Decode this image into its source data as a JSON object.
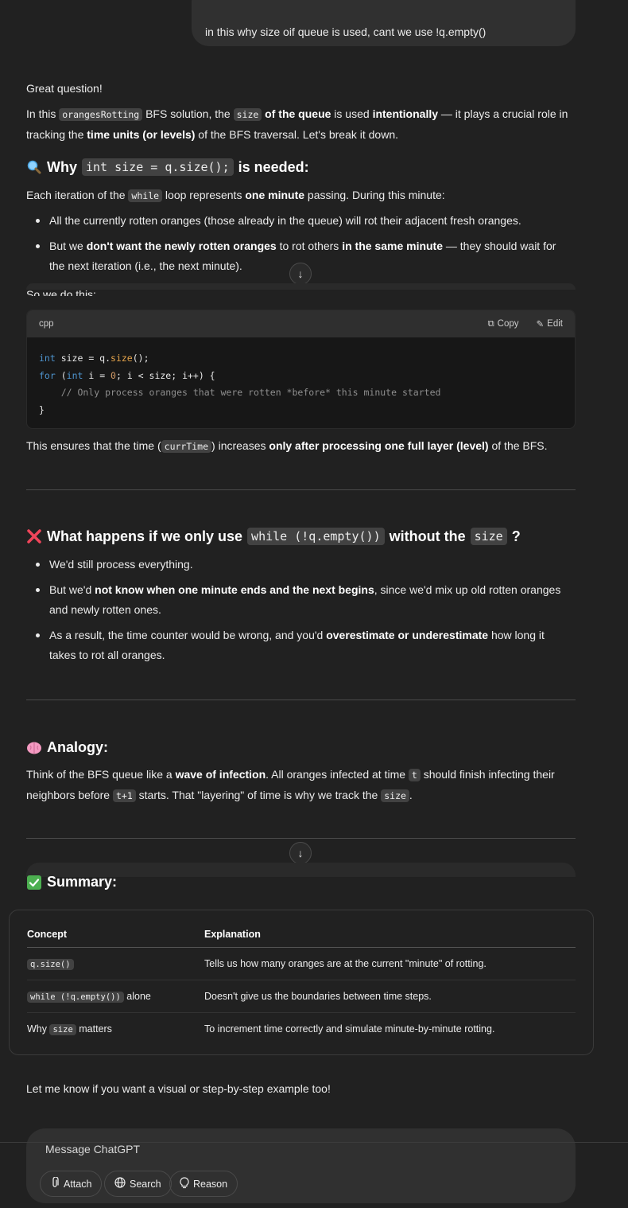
{
  "user_message": "in this why size oif queue is used, cant we use !q.empty()",
  "intro": {
    "greeting": "Great question!",
    "p1_a": "In this ",
    "p1_code1": "orangesRotting",
    "p1_b": " BFS solution, the ",
    "p1_code2": "size",
    "p1_c": " of the queue",
    "p1_d": " is used ",
    "p1_e": "intentionally",
    "p1_f": " — it plays a crucial role in",
    "p1_g": "tracking the ",
    "p1_h": "time units (or levels)",
    "p1_i": " of the BFS traversal. Let's break it down."
  },
  "section1": {
    "emoji_icon": "magnifier-icon",
    "heading_a": "Why ",
    "heading_code": "int size = q.size();",
    "heading_b": " is needed:",
    "p_a": "Each iteration of the ",
    "p_code": "while",
    "p_b": " loop represents ",
    "p_c": "one minute",
    "p_d": " passing. During this minute:",
    "bullet1": "All the currently rotten oranges (those already in the queue) will rot their adjacent fresh oranges.",
    "bullet2_a": "But we ",
    "bullet2_b": "don't want the newly rotten oranges",
    "bullet2_c": " to rot others ",
    "bullet2_d": "in the same minute",
    "bullet2_e": " — they should wait for",
    "bullet2_f": "the next iteration (i.e., the next minute).",
    "partial_text": "So we do this:"
  },
  "code_block": {
    "language": "cpp",
    "copy_label": "Copy",
    "edit_label": "Edit",
    "line1_a": "int",
    "line1_b": " size = q.",
    "line1_c": "size",
    "line1_d": "();",
    "line2_a": "for",
    "line2_b": " (",
    "line2_c": "int",
    "line2_d": " i = ",
    "line2_e": "0",
    "line2_f": "; i < size; i++) {",
    "line3": "    // Only process oranges that were rotten *before* this minute started",
    "line4": "}"
  },
  "after_code": {
    "a": "This ensures that the time (",
    "code": "currTime",
    "b": ") increases ",
    "c": "only after processing one full layer (level)",
    "d": " of the BFS."
  },
  "section2": {
    "emoji_icon": "red-x-icon",
    "heading_a": "What happens if we only use ",
    "heading_code1": "while (!q.empty())",
    "heading_b": " without the ",
    "heading_code2": "size",
    "heading_c": "?",
    "bullet1": "We'd still process everything.",
    "bullet2_a": "But we'd ",
    "bullet2_b": "not know when one minute ends and the next begins",
    "bullet2_c": ", since we'd mix up old rotten oranges",
    "bullet2_d": "and newly rotten ones.",
    "bullet3_a": "As a result, the time counter would be wrong, and you'd ",
    "bullet3_b": "overestimate or underestimate",
    "bullet3_c": " how long it",
    "bullet3_d": "takes to rot all oranges."
  },
  "section3": {
    "emoji_icon": "brain-icon",
    "heading": "Analogy:",
    "p_a": "Think of the BFS queue like a ",
    "p_b": "wave of infection",
    "p_c": ". All oranges infected at time ",
    "p_code1": "t",
    "p_d": " should finish infecting their",
    "p_e": "neighbors before ",
    "p_code2": "t+1",
    "p_f": " starts. That \"layering\" of time is why we track the ",
    "p_code3": "size",
    "p_g": "."
  },
  "section4": {
    "emoji_icon": "check-mark-icon",
    "heading": "Summary:"
  },
  "summary_table": {
    "headers": [
      "Concept",
      "Explanation"
    ],
    "rows": [
      {
        "concept_code": "q.size()",
        "concept_text": "",
        "explanation": "Tells us how many oranges are at the current \"minute\" of rotting."
      },
      {
        "concept_code": "while (!q.empty())",
        "concept_text": " alone",
        "explanation": "Doesn't give us the boundaries between time steps."
      },
      {
        "concept_prefix": "Why ",
        "concept_code": "size",
        "concept_text": " matters",
        "explanation": "To increment time correctly and simulate minute-by-minute rotting."
      }
    ]
  },
  "closing": "Let me know if you want a visual or step-by-step example too!",
  "composer": {
    "placeholder": "Message ChatGPT",
    "attach_label": "Attach",
    "search_label": "Search",
    "reason_label": "Reason"
  },
  "colors": {
    "background": "#212121",
    "bubble": "#303030",
    "keyword": "#4e94ce",
    "function": "#e5a44b",
    "comment": "#8e8e8e"
  }
}
